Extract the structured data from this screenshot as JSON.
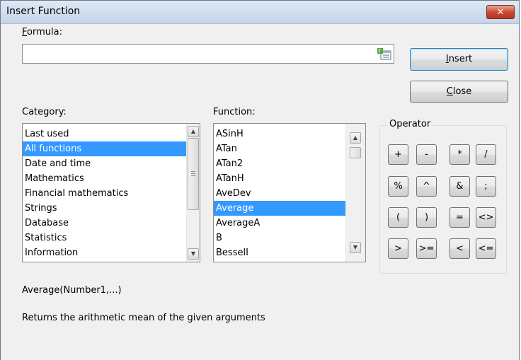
{
  "window": {
    "title": "Insert Function",
    "close_glyph": "✕"
  },
  "formula": {
    "label": "Formula:",
    "label_access_key": "F",
    "value": "",
    "icon": "insert-formula-icon"
  },
  "buttons": {
    "insert": "Insert",
    "insert_access_key": "I",
    "close": "Close",
    "close_access_key": "C"
  },
  "category": {
    "label": "Category:",
    "items": [
      "Last used",
      "All functions",
      "Date and time",
      "Mathematics",
      "Financial mathematics",
      "Strings",
      "Database",
      "Statistics",
      "Information"
    ],
    "selected_index": 1
  },
  "function": {
    "label": "Function:",
    "items": [
      "ASinH",
      "ATan",
      "ATan2",
      "ATanH",
      "AveDev",
      "Average",
      "AverageA",
      "B",
      "BesselI"
    ],
    "selected_index": 5
  },
  "operator": {
    "label": "Operator",
    "rows": [
      [
        "+",
        "-",
        "*",
        "/"
      ],
      [
        "%",
        "^",
        "&",
        ";"
      ],
      [
        "(",
        ")",
        "=",
        "<>"
      ],
      [
        ">",
        ">=",
        "<",
        "<="
      ]
    ]
  },
  "syntax": "Average(Number1,...)",
  "description": "Returns the arithmetic mean of the given arguments"
}
